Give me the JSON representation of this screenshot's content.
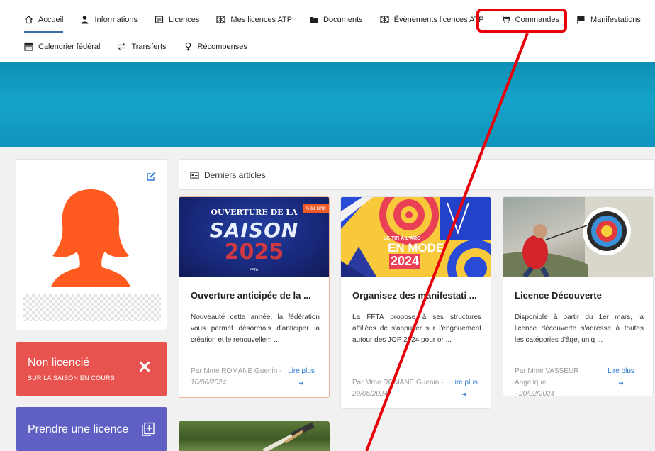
{
  "nav": {
    "row1": [
      {
        "label": "Accueil",
        "icon": "home-icon",
        "active": true
      },
      {
        "label": "Informations",
        "icon": "user-icon"
      },
      {
        "label": "Licences",
        "icon": "license-card-icon"
      },
      {
        "label": "Mes licences ATP",
        "icon": "atp-license-icon"
      },
      {
        "label": "Documents",
        "icon": "folder-icon"
      },
      {
        "label": "Évènements licences ATP",
        "icon": "atp-events-icon"
      },
      {
        "label": "Commandes",
        "icon": "cart-icon",
        "highlighted": true
      },
      {
        "label": "Manifestations",
        "icon": "flag-icon"
      }
    ],
    "row2": [
      {
        "label": "Calendrier fédéral",
        "icon": "calendar-icon"
      },
      {
        "label": "Transferts",
        "icon": "transfer-icon"
      },
      {
        "label": "Récompenses",
        "icon": "award-icon"
      }
    ]
  },
  "profile": {
    "status_title": "Non licencié",
    "status_subtitle": "SUR LA SAISON EN COURS",
    "take_license_label": "Prendre une licence"
  },
  "articles": {
    "header": "Derniers articles",
    "cards": [
      {
        "image_lines": [
          "OUVERTURE DE LA",
          "SAISON",
          "2025"
        ],
        "image_caption": "FFTA",
        "badge": "A la une",
        "title": "Ouverture anticipée de la ...",
        "excerpt": "Nouveauté cette année, la fédération vous permet désormais d'anticiper la création et le renouvellem ...",
        "author": "Par Mme ROMANE Guenin -",
        "date": "10/06/2024",
        "more": "Lire plus"
      },
      {
        "image_lines": [
          "LE TIR À L'ARC",
          "EN MODE",
          "2024"
        ],
        "title": "Organisez des manifestati ...",
        "excerpt": "La FFTA propose à ses structures affiliées de s'appuyer sur l'engouement autour des JOP 2024 pour or ...",
        "author": "Par Mme ROMANE Guenin -",
        "date": "29/05/2024",
        "more": "Lire plus"
      },
      {
        "title": "Licence Découverte",
        "excerpt": "Disponible à partir du 1er mars, la licence découverte s'adresse à toutes les catégories d'âge, uniq ...",
        "author": "Par Mme VASSEUR Angelique",
        "date": "- 20/02/2024",
        "more": "Lire plus"
      }
    ]
  },
  "colors": {
    "hero": "#16a3c9",
    "status": "#e8534f",
    "take_license": "#5f5fc4",
    "avatar": "#ff5a1f",
    "link": "#2b7bd3",
    "annotation": "#e8000b"
  }
}
